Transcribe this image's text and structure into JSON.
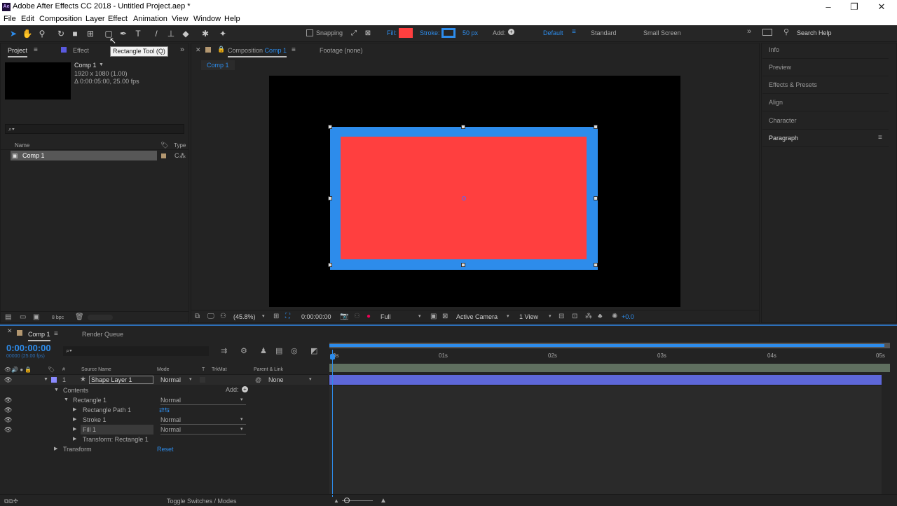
{
  "window": {
    "title": "Adobe After Effects CC 2018 - Untitled Project.aep *",
    "logo": "Ae"
  },
  "menu": [
    "File",
    "Edit",
    "Composition",
    "Layer",
    "Effect",
    "Animation",
    "View",
    "Window",
    "Help"
  ],
  "toolbar": {
    "snapping": "Snapping",
    "fill_label": "Fill:",
    "fill_color": "#ff3f3f",
    "stroke_label": "Stroke:",
    "stroke_color": "#2d8ceb",
    "stroke_width": "50 px",
    "add_label": "Add:",
    "workspaces": [
      "Default",
      "Standard",
      "Small Screen"
    ],
    "search_placeholder": "Search Help",
    "tooltip": "Rectangle Tool (Q)"
  },
  "project": {
    "tab": "Project",
    "tab2": "Effect Controls",
    "comp_name": "Comp 1",
    "comp_res": "1920 x 1080 (1.00)",
    "comp_dur": "Δ 0:00:05:00, 25.00 fps",
    "search_glyph": "⌕▾",
    "col_name": "Name",
    "col_type": "Type",
    "items": [
      {
        "name": "Comp 1",
        "type": "C"
      }
    ],
    "bpc": "8 bpc"
  },
  "composition": {
    "tab_prefix": "Composition",
    "tab_name": "Comp 1",
    "footage": "Footage (none)",
    "sub_tab": "Comp 1",
    "zoom": "(45.8%)",
    "time": "0:00:00:00",
    "resolution": "Full",
    "camera": "Active Camera",
    "views": "1 View",
    "exposure": "+0.0",
    "shape_fill": "#ff3f3f",
    "shape_stroke": "#2d8ceb"
  },
  "right_panels": [
    "Info",
    "Preview",
    "Effects & Presets",
    "Align",
    "Character",
    "Paragraph"
  ],
  "timeline": {
    "tab": "Comp 1",
    "tab2": "Render Queue",
    "timecode": "0:00:00:00",
    "timecode_sub": "00000 (25.00 fps)",
    "search_glyph": "⌕▾",
    "headers": {
      "num": "#",
      "source": "Source Name",
      "mode": "Mode",
      "t": "T",
      "trkmat": "TrkMat",
      "parent": "Parent & Link"
    },
    "layer": {
      "num": "1",
      "name": "Shape Layer 1",
      "mode": "Normal",
      "parent": "None"
    },
    "props": {
      "contents": "Contents",
      "add": "Add:",
      "rect": "Rectangle 1",
      "rect_mode": "Normal",
      "path": "Rectangle Path 1",
      "stroke": "Stroke 1",
      "stroke_mode": "Normal",
      "fill": "Fill 1",
      "fill_mode": "Normal",
      "transform_rect": "Transform: Rectangle 1",
      "transform": "Transform",
      "reset": "Reset"
    },
    "ruler": [
      "0s",
      "01s",
      "02s",
      "03s",
      "04s",
      "05s"
    ],
    "toggle": "Toggle Switches / Modes"
  }
}
